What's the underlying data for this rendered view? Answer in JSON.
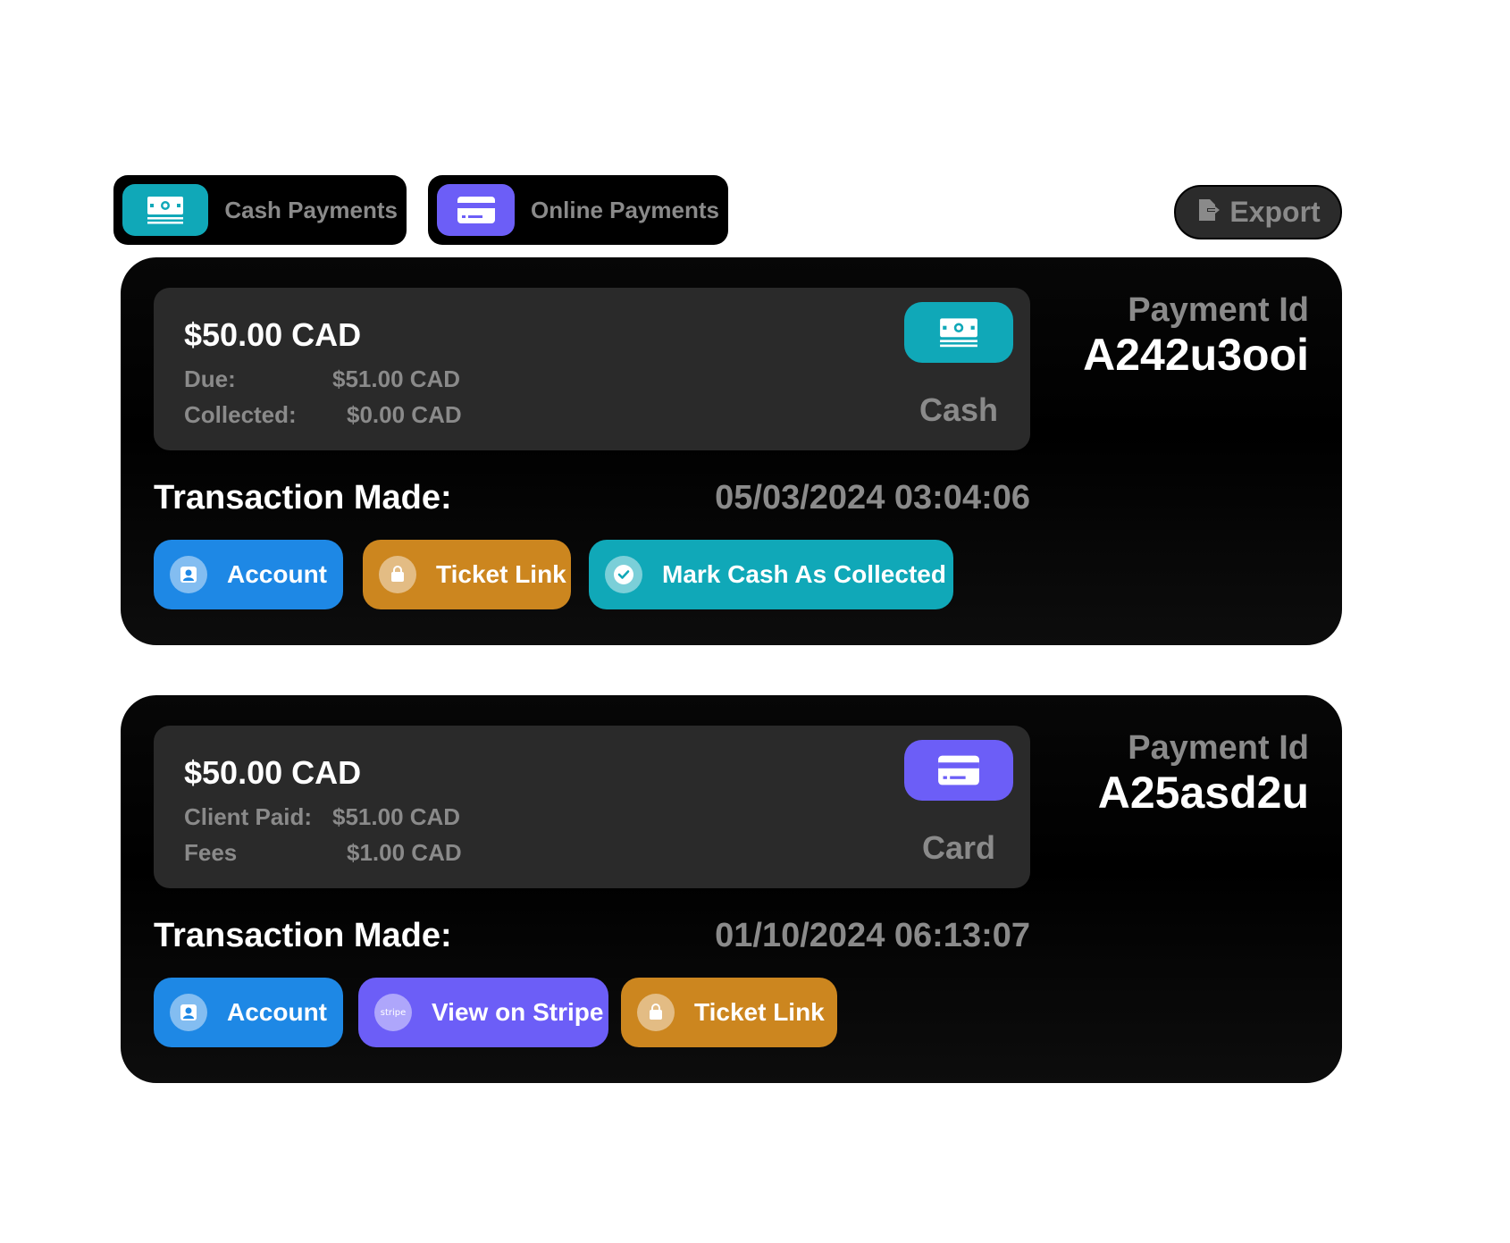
{
  "tabs": {
    "cash": {
      "label": "Cash Payments",
      "color": "#10a8b8",
      "icon": "cash-icon"
    },
    "online": {
      "label": "Online Payments",
      "color": "#6c5ef7",
      "icon": "credit-card-icon"
    }
  },
  "export": {
    "label": "Export",
    "icon": "export-icon"
  },
  "payments": [
    {
      "amount": "$50.00 CAD",
      "row1_label": "Due:",
      "row1_value": "$51.00 CAD",
      "row2_label": "Collected:",
      "row2_value": "$0.00 CAD",
      "method": "Cash",
      "method_icon": "cash-icon",
      "payment_id_caption": "Payment Id",
      "payment_id": "A242u3ooi",
      "tx_label": "Transaction Made:",
      "tx_date": "05/03/2024 03:04:06",
      "actions": [
        {
          "label": "Account",
          "icon": "account-icon",
          "color": "#1e88e5"
        },
        {
          "label": "Ticket Link",
          "icon": "ticket-bag-icon",
          "color": "#cc861f"
        },
        {
          "label": "Mark Cash As Collected",
          "icon": "check-circle-icon",
          "color": "#10a8b8"
        }
      ]
    },
    {
      "amount": "$50.00 CAD",
      "row1_label": "Client Paid:",
      "row1_value": "$51.00 CAD",
      "row2_label": "Fees",
      "row2_value": "$1.00 CAD",
      "method": "Card",
      "method_icon": "credit-card-icon",
      "payment_id_caption": "Payment Id",
      "payment_id": "A25asd2u",
      "tx_label": "Transaction Made:",
      "tx_date": "01/10/2024 06:13:07",
      "actions": [
        {
          "label": "Account",
          "icon": "account-icon",
          "color": "#1e88e5"
        },
        {
          "label": "View on Stripe",
          "icon": "stripe-icon",
          "icon_text": "stripe",
          "color": "#6c5ef7"
        },
        {
          "label": "Ticket Link",
          "icon": "ticket-bag-icon",
          "color": "#cc861f"
        }
      ]
    }
  ]
}
